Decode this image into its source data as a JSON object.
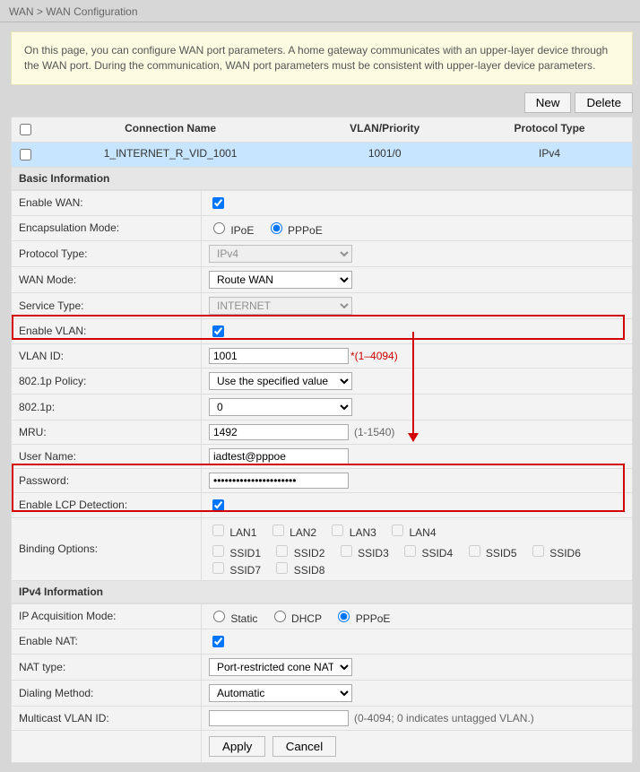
{
  "breadcrumb": "WAN > WAN Configuration",
  "info_text": "On this page, you can configure WAN port parameters. A home gateway communicates with an upper-layer device through the WAN port. During the communication, WAN port parameters must be consistent with upper-layer device parameters.",
  "toolbar": {
    "new": "New",
    "delete": "Delete"
  },
  "grid": {
    "headers": {
      "name": "Connection Name",
      "vlan": "VLAN/Priority",
      "proto": "Protocol Type"
    },
    "row": {
      "name": "1_INTERNET_R_VID_1001",
      "vlan": "1001/0",
      "proto": "IPv4"
    }
  },
  "sections": {
    "basic": "Basic Information",
    "ipv4": "IPv4 Information"
  },
  "labels": {
    "enable_wan": "Enable WAN:",
    "encaps": "Encapsulation Mode:",
    "protocol": "Protocol Type:",
    "wan_mode": "WAN Mode:",
    "service": "Service Type:",
    "enable_vlan": "Enable VLAN:",
    "vlan_id": "VLAN ID:",
    "policy8021p": "802.1p Policy:",
    "v8021p": "802.1p:",
    "mru": "MRU:",
    "user": "User Name:",
    "password": "Password:",
    "lcp": "Enable LCP Detection:",
    "binding": "Binding Options:",
    "ip_mode": "IP Acquisition Mode:",
    "nat": "Enable NAT:",
    "nat_type": "NAT type:",
    "dialing": "Dialing Method:",
    "mcast": "Multicast VLAN ID:"
  },
  "values": {
    "encaps_ipoe": "IPoE",
    "encaps_pppoe": "PPPoE",
    "protocol": "IPv4",
    "wan_mode": "Route WAN",
    "service": "INTERNET",
    "vlan_id": "1001",
    "vlan_hint": "*(1–4094)",
    "policy": "Use the specified value",
    "v8021p": "0",
    "mru": "1492",
    "mru_hint": "(1-1540)",
    "user": "iadtest@pppoe",
    "password": "••••••••••••••••••••••",
    "lan1": "LAN1",
    "lan2": "LAN2",
    "lan3": "LAN3",
    "lan4": "LAN4",
    "ssid1": "SSID1",
    "ssid2": "SSID2",
    "ssid3": "SSID3",
    "ssid4": "SSID4",
    "ssid5": "SSID5",
    "ssid6": "SSID6",
    "ssid7": "SSID7",
    "ssid8": "SSID8",
    "ip_static": "Static",
    "ip_dhcp": "DHCP",
    "ip_pppoe": "PPPoE",
    "nat_type": "Port-restricted cone NAT",
    "dialing": "Automatic",
    "mcast_hint": "(0-4094; 0 indicates untagged VLAN.)"
  },
  "buttons": {
    "apply": "Apply",
    "cancel": "Cancel"
  }
}
